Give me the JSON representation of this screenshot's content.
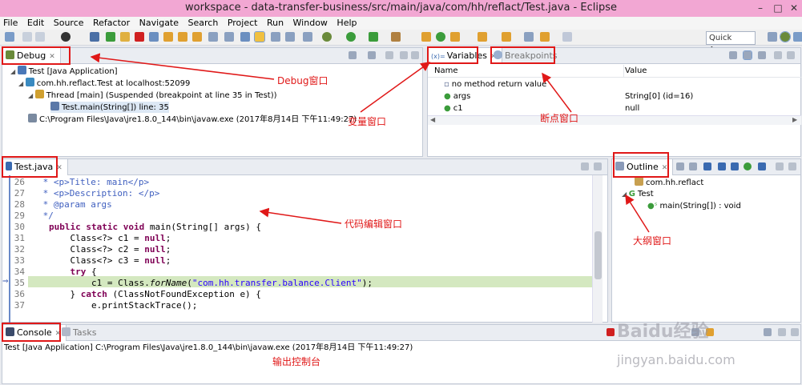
{
  "window": {
    "title": "workspace - data-transfer-business/src/main/java/com/hh/reflact/Test.java - Eclipse",
    "minimize": "–",
    "maximize": "□",
    "close": "✕"
  },
  "menu": [
    "File",
    "Edit",
    "Source",
    "Refactor",
    "Navigate",
    "Search",
    "Project",
    "Run",
    "Window",
    "Help"
  ],
  "quick_access": "Quick Access",
  "debug": {
    "tab": "Debug",
    "tree": [
      "Test [Java Application]",
      "com.hh.reflact.Test at localhost:52099",
      "Thread [main] (Suspended (breakpoint at line 35 in Test))",
      "Test.main(String[]) line: 35",
      "C:\\Program Files\\Java\\jre1.8.0_144\\bin\\javaw.exe (2017年8月14日 下午11:49:27)"
    ]
  },
  "variables": {
    "tab": "Variables",
    "tab2": "Breakpoints",
    "col_name": "Name",
    "col_value": "Value",
    "rows": [
      {
        "name": "no method return value",
        "value": ""
      },
      {
        "name": "args",
        "value": "String[0]  (id=16)"
      },
      {
        "name": "c1",
        "value": "null"
      }
    ]
  },
  "editor": {
    "tab": "Test.java",
    "lines": [
      "26",
      "27",
      "28",
      "29",
      "30",
      "31",
      "32",
      "33",
      "34",
      "35",
      "36",
      "37"
    ],
    "code": [
      " * <p>Title: main</p>",
      " * <p>Description: </p>",
      " * @param args",
      " */",
      "public static void main(String[] args) {",
      "    Class<?> c1 = null;",
      "    Class<?> c2 = null;",
      "    Class<?> c3 = null;",
      "    try {",
      "        c1 = Class.forName(\"com.hh.transfer.balance.Client\");",
      "    } catch (ClassNotFoundException e) {",
      "        e.printStackTrace();"
    ]
  },
  "outline": {
    "tab": "Outline",
    "items": [
      "com.hh.reflact",
      "Test",
      "main(String[]) : void"
    ]
  },
  "console": {
    "tab": "Console",
    "tab2": "Tasks",
    "text": "Test [Java Application] C:\\Program Files\\Java\\jre1.8.0_144\\bin\\javaw.exe (2017年8月14日 下午11:49:27)"
  },
  "annotations": {
    "debug": "Debug窗口",
    "variables": "变量窗口",
    "breakpoints": "断点窗口",
    "editor": "代码编辑窗口",
    "outline": "大纲窗口",
    "console": "输出控制台"
  },
  "watermark": {
    "logo": "Baidu经验",
    "url": "jingyan.baidu.com"
  },
  "colors": {
    "annotation": "#e01818",
    "keyword": "#7f0055",
    "comment": "#3f5fbf",
    "string": "#2a00ff",
    "current_line": "#d4e8c0"
  }
}
